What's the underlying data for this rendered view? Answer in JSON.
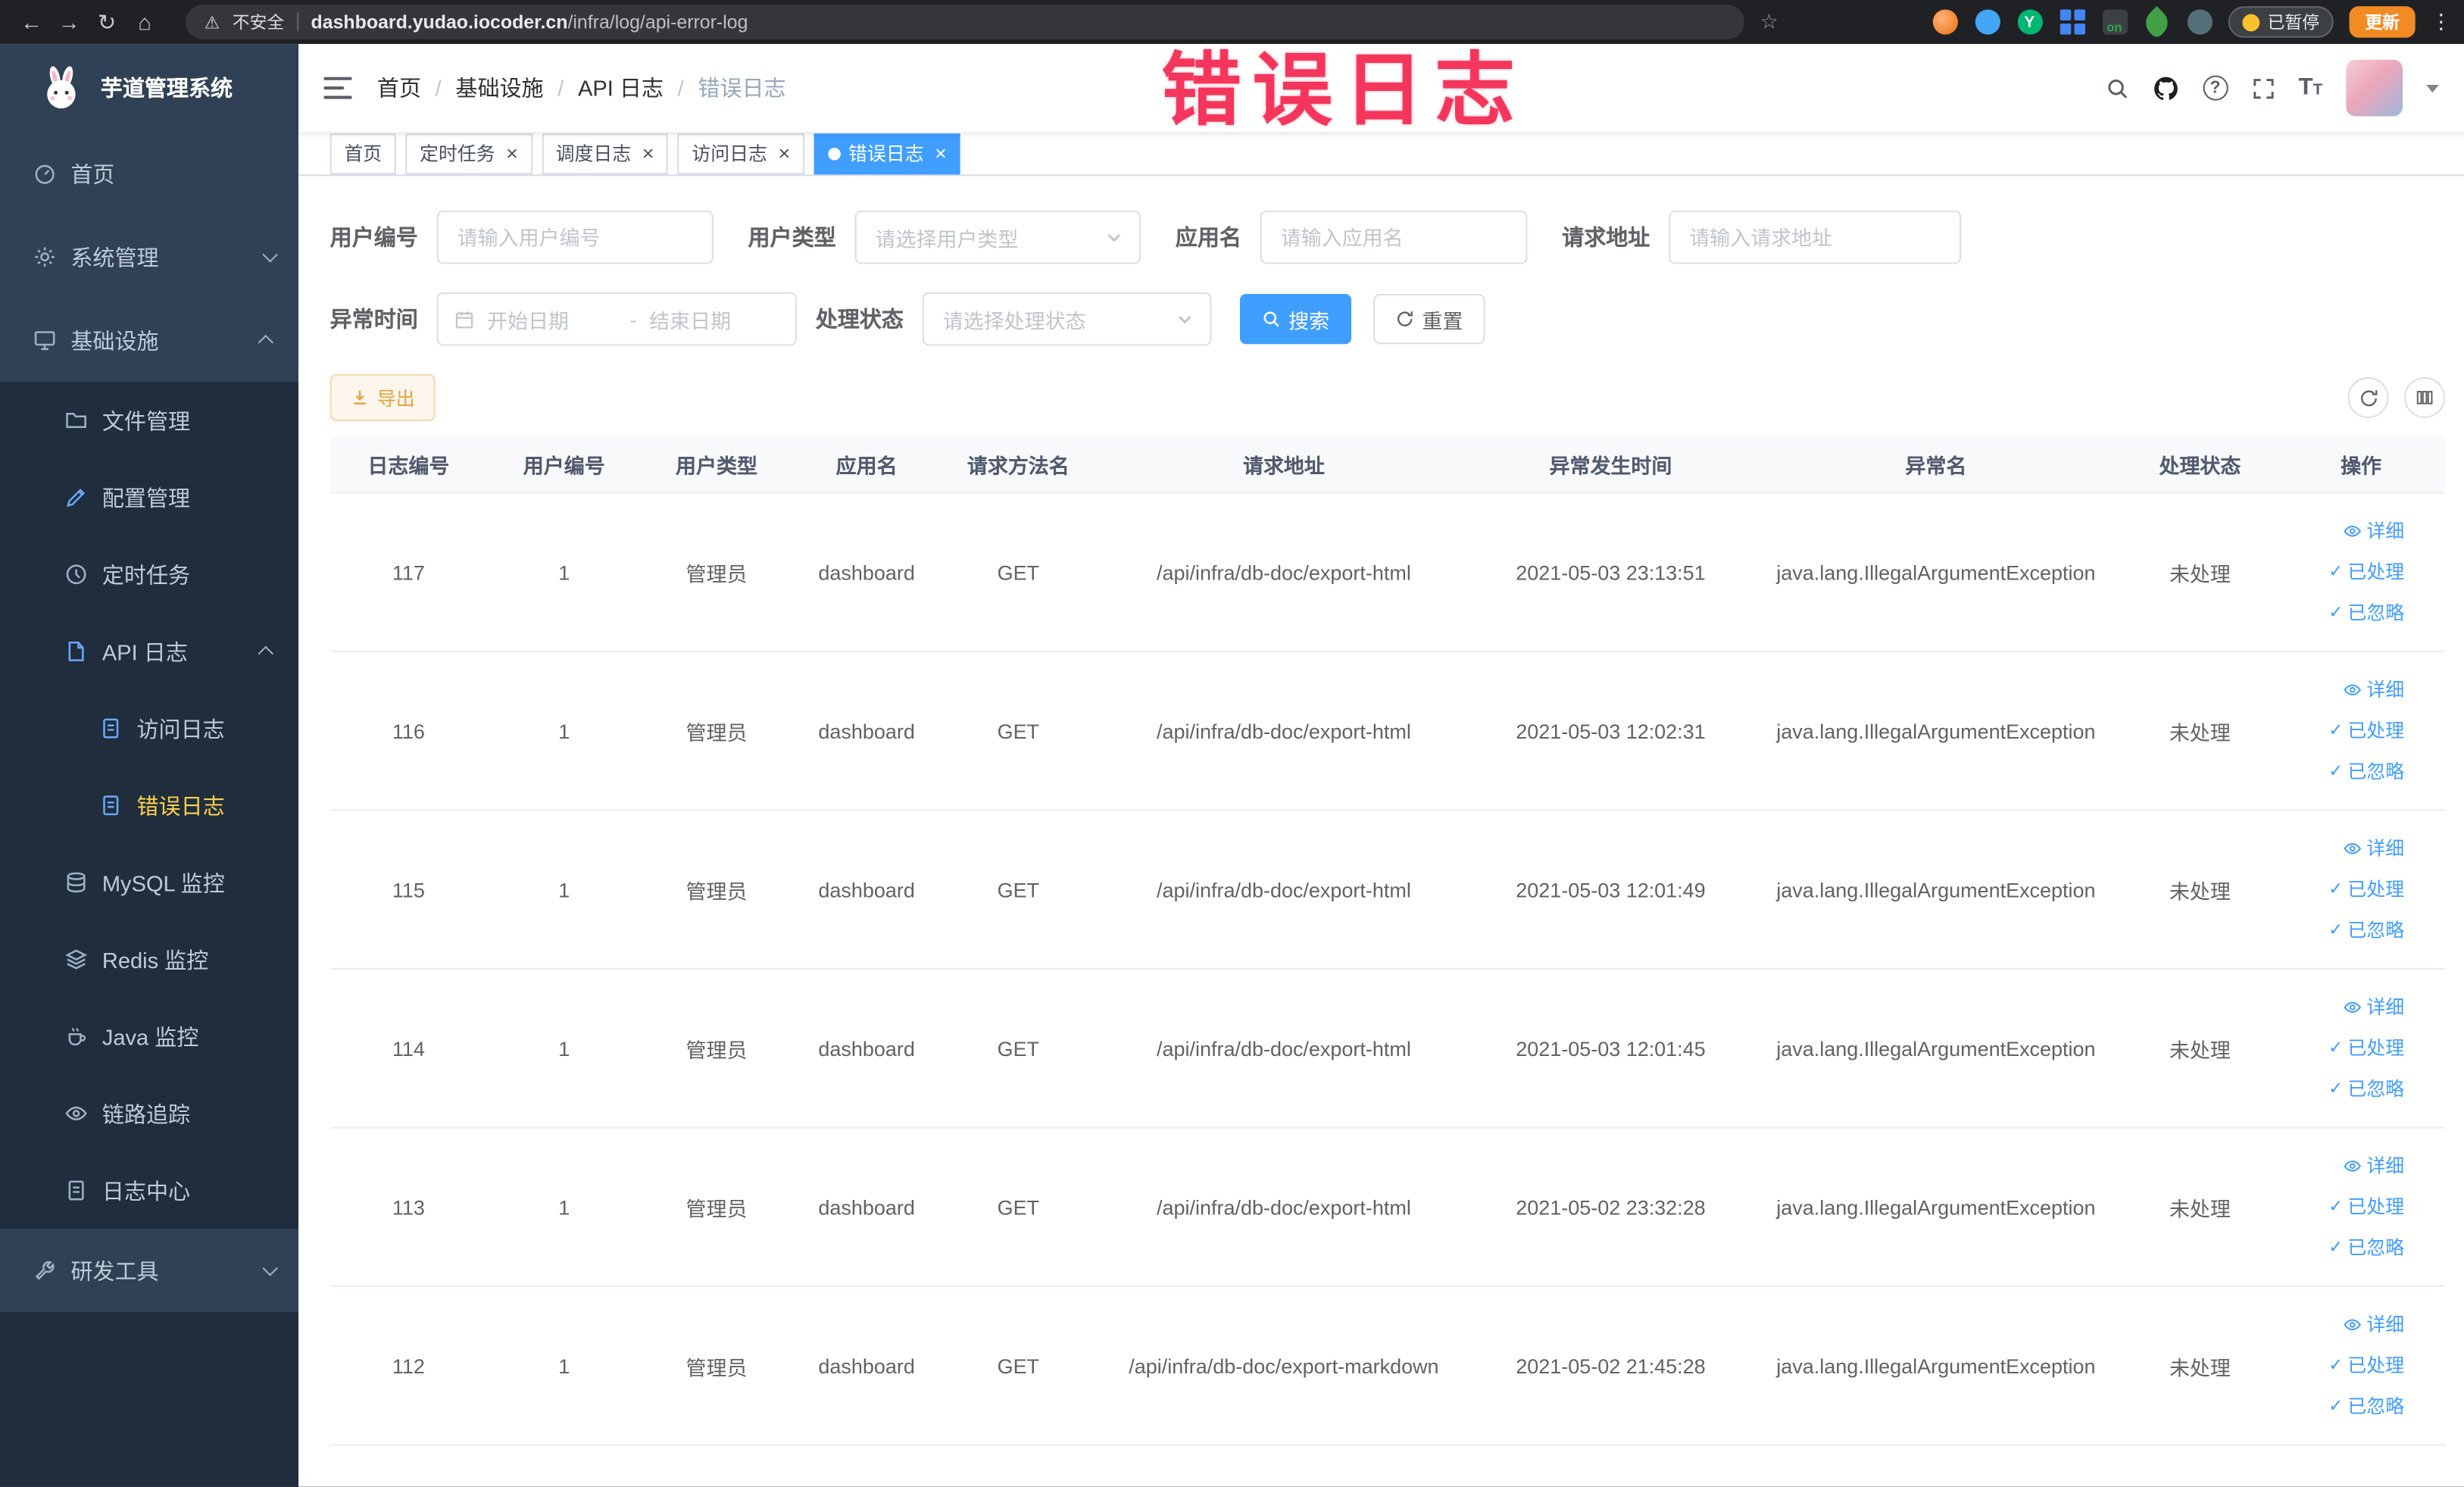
{
  "watermark": {
    "text": "错误日志"
  },
  "browser": {
    "security_label": "不安全",
    "url_domain": "dashboard.yudao.iocoder.cn",
    "url_path": "/infra/log/api-error-log",
    "ext_letter": "Y",
    "extension_badge": "on",
    "paused_label": "已暂停",
    "update_label": "更新"
  },
  "sidebar": {
    "app_title": "芋道管理系统",
    "items": [
      {
        "label": "首页"
      },
      {
        "label": "系统管理"
      },
      {
        "label": "基础设施"
      },
      {
        "label": "文件管理"
      },
      {
        "label": "配置管理"
      },
      {
        "label": "定时任务"
      },
      {
        "label": "API 日志"
      },
      {
        "label": "访问日志"
      },
      {
        "label": "错误日志"
      },
      {
        "label": "MySQL 监控"
      },
      {
        "label": "Redis 监控"
      },
      {
        "label": "Java 监控"
      },
      {
        "label": "链路追踪"
      },
      {
        "label": "日志中心"
      },
      {
        "label": "研发工具"
      }
    ]
  },
  "breadcrumb": {
    "separator": "/",
    "items": [
      "首页",
      "基础设施",
      "API 日志",
      "错误日志"
    ]
  },
  "tags": [
    {
      "label": "首页"
    },
    {
      "label": "定时任务"
    },
    {
      "label": "调度日志"
    },
    {
      "label": "访问日志"
    },
    {
      "label": "错误日志"
    }
  ],
  "filters": {
    "user_id": {
      "label": "用户编号",
      "placeholder": "请输入用户编号"
    },
    "user_type": {
      "label": "用户类型",
      "placeholder": "请选择用户类型"
    },
    "app_name": {
      "label": "应用名",
      "placeholder": "请输入应用名"
    },
    "request_url": {
      "label": "请求地址",
      "placeholder": "请输入请求地址"
    },
    "exception_time": {
      "label": "异常时间",
      "start_placeholder": "开始日期",
      "separator": "-",
      "end_placeholder": "结束日期"
    },
    "process_status": {
      "label": "处理状态",
      "placeholder": "请选择处理状态"
    },
    "search_label": "搜索",
    "reset_label": "重置"
  },
  "toolbar": {
    "export_label": "导出"
  },
  "table": {
    "columns": [
      "日志编号",
      "用户编号",
      "用户类型",
      "应用名",
      "请求方法名",
      "请求地址",
      "异常发生时间",
      "异常名",
      "处理状态",
      "操作"
    ],
    "actions": {
      "detail": "详细",
      "processed": "已处理",
      "ignored": "已忽略"
    },
    "rows": [
      {
        "id": "117",
        "user_id": "1",
        "user_type": "管理员",
        "app": "dashboard",
        "method": "GET",
        "url": "/api/infra/db-doc/export-html",
        "time": "2021-05-03 23:13:51",
        "exception": "java.lang.IllegalArgumentException",
        "status": "未处理"
      },
      {
        "id": "116",
        "user_id": "1",
        "user_type": "管理员",
        "app": "dashboard",
        "method": "GET",
        "url": "/api/infra/db-doc/export-html",
        "time": "2021-05-03 12:02:31",
        "exception": "java.lang.IllegalArgumentException",
        "status": "未处理"
      },
      {
        "id": "115",
        "user_id": "1",
        "user_type": "管理员",
        "app": "dashboard",
        "method": "GET",
        "url": "/api/infra/db-doc/export-html",
        "time": "2021-05-03 12:01:49",
        "exception": "java.lang.IllegalArgumentException",
        "status": "未处理"
      },
      {
        "id": "114",
        "user_id": "1",
        "user_type": "管理员",
        "app": "dashboard",
        "method": "GET",
        "url": "/api/infra/db-doc/export-html",
        "time": "2021-05-03 12:01:45",
        "exception": "java.lang.IllegalArgumentException",
        "status": "未处理"
      },
      {
        "id": "113",
        "user_id": "1",
        "user_type": "管理员",
        "app": "dashboard",
        "method": "GET",
        "url": "/api/infra/db-doc/export-html",
        "time": "2021-05-02 23:32:28",
        "exception": "java.lang.IllegalArgumentException",
        "status": "未处理"
      },
      {
        "id": "112",
        "user_id": "1",
        "user_type": "管理员",
        "app": "dashboard",
        "method": "GET",
        "url": "/api/infra/db-doc/export-markdown",
        "time": "2021-05-02 21:45:28",
        "exception": "java.lang.IllegalArgumentException",
        "status": "未处理"
      }
    ]
  }
}
